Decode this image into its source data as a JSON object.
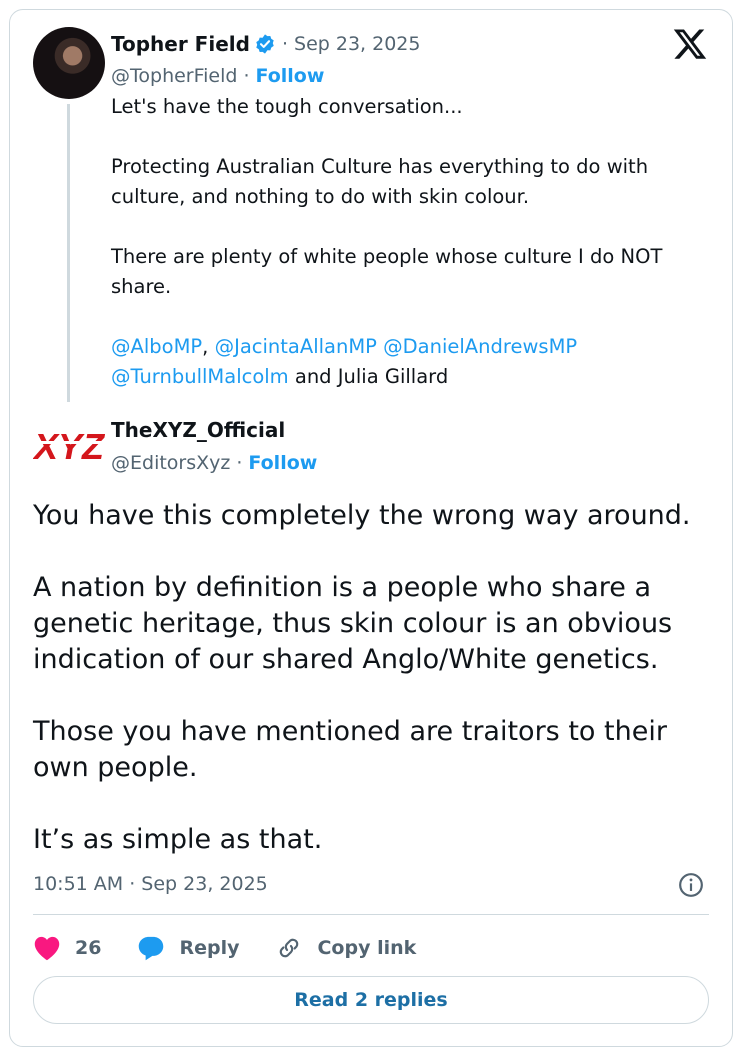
{
  "quoted_tweet": {
    "author_name": "Topher Field",
    "date": "· Sep 23, 2025",
    "handle": "@TopherField",
    "separator": "·",
    "follow_label": "Follow",
    "paragraphs": [
      "Let's have the tough conversation...",
      "Protecting Australian Culture has everything to do with culture, and nothing to do with skin colour.",
      "There are plenty of white people whose culture I do NOT share."
    ],
    "mentions": {
      "m1": "@AlboMP",
      "comma": ",",
      "m2": "@JacintaAllanMP",
      "m3": "@DanielAndrewsMP",
      "m4": "@TurnbullMalcolm",
      "tail": "and Julia Gillard"
    }
  },
  "reply_tweet": {
    "author_name": "TheXYZ_Official",
    "avatar_text": "XYZ",
    "handle": "@EditorsXyz",
    "separator": "·",
    "follow_label": "Follow",
    "paragraphs": [
      "You have this completely the wrong way around.",
      "A nation by definition is a people who share a genetic heritage, thus skin colour is an obvious indication of our shared Anglo/White genetics.",
      "Those you have mentioned are traitors to their own people.",
      "It’s as simple as that."
    ],
    "timestamp": "10:51 AM · Sep 23, 2025"
  },
  "actions": {
    "like_count": "26",
    "reply_label": "Reply",
    "copy_label": "Copy link"
  },
  "read_replies_label": "Read 2 replies",
  "colors": {
    "accent": "#1d9bf0",
    "like": "#f91880",
    "muted": "#536471",
    "border": "#cfd9de",
    "brand_red": "#d4161c"
  },
  "icons": [
    "verified-badge-icon",
    "x-logo-icon",
    "info-icon",
    "heart-icon",
    "reply-bubble-icon",
    "link-icon"
  ]
}
